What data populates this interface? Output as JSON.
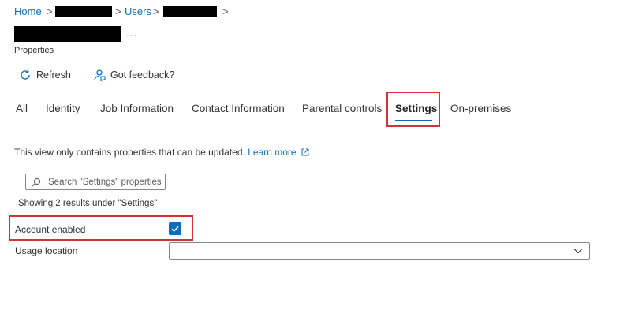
{
  "breadcrumb": {
    "home": "Home",
    "sep": ">",
    "users": "Users"
  },
  "title": {
    "ellipsis": "..."
  },
  "subtitle": "Properties",
  "toolbar": {
    "refresh": "Refresh",
    "feedback": "Got feedback?"
  },
  "tabs": [
    {
      "label": "All",
      "active": false
    },
    {
      "label": "Identity",
      "active": false
    },
    {
      "label": "Job Information",
      "active": false
    },
    {
      "label": "Contact Information",
      "active": false
    },
    {
      "label": "Parental controls",
      "active": false
    },
    {
      "label": "Settings",
      "active": true
    },
    {
      "label": "On-premises",
      "active": false
    }
  ],
  "info": {
    "text": "This view only contains properties that can be updated.",
    "link": "Learn more"
  },
  "search": {
    "placeholder": "Search \"Settings\" properties"
  },
  "results_text": "Showing 2 results under \"Settings\"",
  "fields": {
    "account_enabled": {
      "label": "Account enabled",
      "checked": true
    },
    "usage_location": {
      "label": "Usage location",
      "value": ""
    }
  },
  "colors": {
    "accent": "#0f6cbd",
    "highlight": "#d13438"
  }
}
